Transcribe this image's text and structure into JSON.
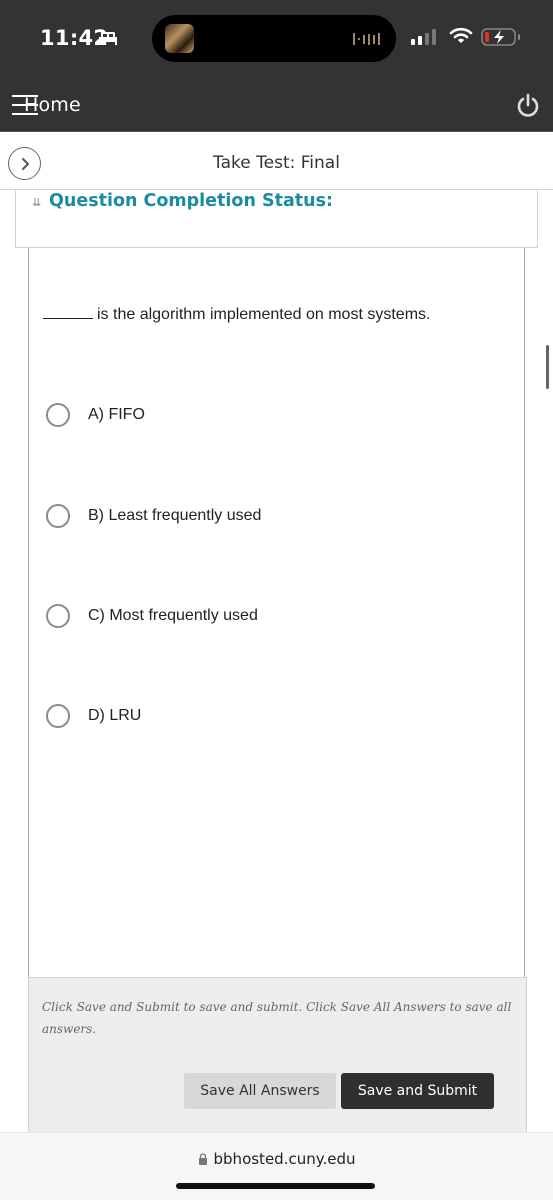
{
  "status_bar": {
    "time": "11:42",
    "icons": [
      "sleep-focus-icon",
      "now-playing-artwork",
      "audio-waveform-icon",
      "cellular-signal-icon",
      "wifi-icon",
      "battery-charging-icon"
    ],
    "battery_color": "#e0301e"
  },
  "header": {
    "home_label": "Home",
    "menu_icon": "menu-icon",
    "power_icon": "power-icon",
    "background": "#333333"
  },
  "subheader": {
    "title": "Take Test: Final",
    "nav_toggle_icon": "chevron-right-icon"
  },
  "completion_status": {
    "title": "Question Completion Status:",
    "accent_color": "#1a8ca0"
  },
  "question": {
    "blank": "_____",
    "text": "is the algorithm implemented on most systems.",
    "options": [
      {
        "label": "A) FIFO",
        "selected": false
      },
      {
        "label": "B) Least frequently used",
        "selected": false
      },
      {
        "label": "C) Most frequently used",
        "selected": false
      },
      {
        "label": "D) LRU",
        "selected": false
      }
    ]
  },
  "footer": {
    "hint": "Click Save and Submit to save and submit. Click Save All Answers to save all answers.",
    "save_all_label": "Save All Answers",
    "submit_label": "Save and Submit"
  },
  "browser": {
    "url": "bbhosted.cuny.edu"
  }
}
